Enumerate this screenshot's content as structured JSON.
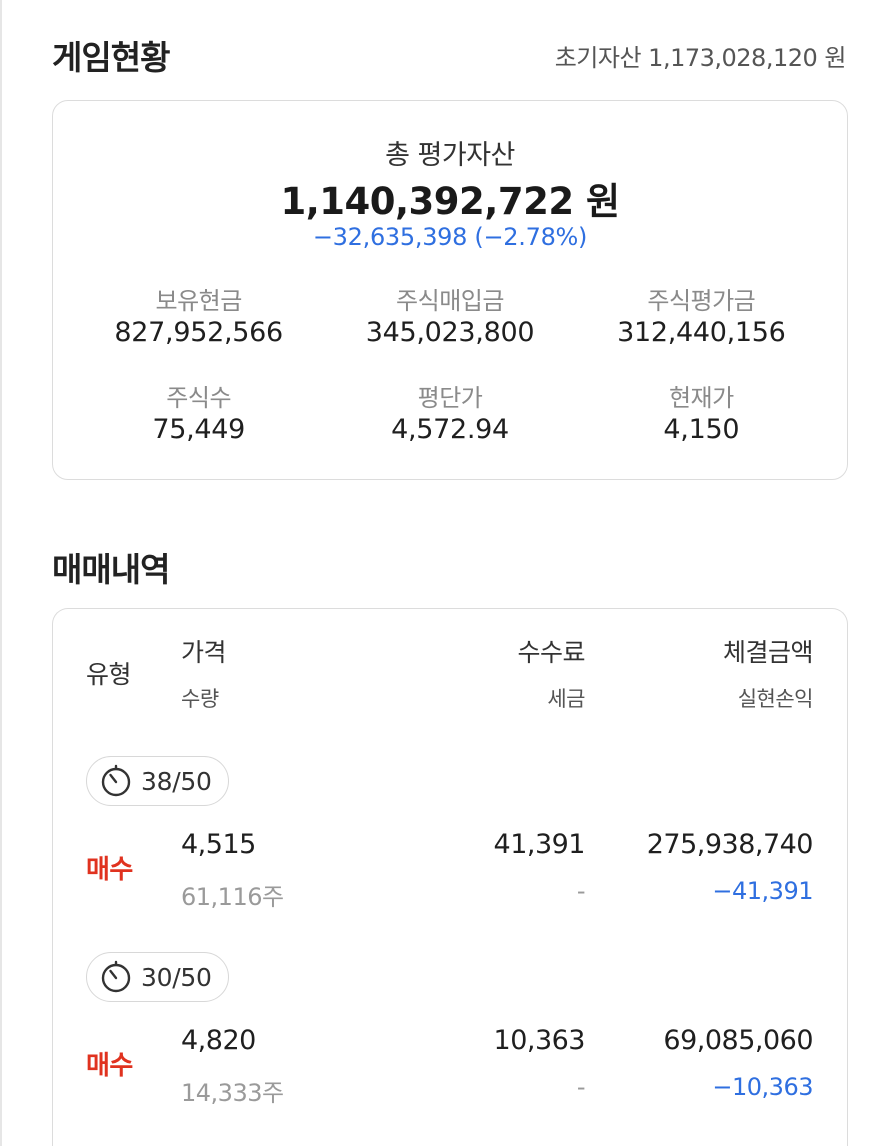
{
  "game_status": {
    "title": "게임현황",
    "initial_assets_label": "초기자산",
    "initial_assets_value": "1,173,028,120",
    "currency": "원"
  },
  "summary": {
    "total_label": "총 평가자산",
    "total_value": "1,140,392,722 원",
    "total_change": "−32,635,398 (−2.78%)",
    "stats": [
      {
        "label": "보유현금",
        "value": "827,952,566"
      },
      {
        "label": "주식매입금",
        "value": "345,023,800"
      },
      {
        "label": "주식평가금",
        "value": "312,440,156"
      },
      {
        "label": "주식수",
        "value": "75,449"
      },
      {
        "label": "평단가",
        "value": "4,572.94"
      },
      {
        "label": "현재가",
        "value": "4,150"
      }
    ]
  },
  "trades": {
    "title": "매매내역",
    "headers": {
      "type": "유형",
      "price": "가격",
      "quantity": "수량",
      "fee": "수수료",
      "tax": "세금",
      "amount": "체결금액",
      "realized": "실현손익"
    },
    "rows": [
      {
        "round": "38/50",
        "type": "매수",
        "price": "4,515",
        "quantity": "61,116주",
        "fee": "41,391",
        "tax": "-",
        "amount": "275,938,740",
        "realized": "−41,391"
      },
      {
        "round": "30/50",
        "type": "매수",
        "price": "4,820",
        "quantity": "14,333주",
        "fee": "10,363",
        "tax": "-",
        "amount": "69,085,060",
        "realized": "−10,363"
      }
    ]
  },
  "colors": {
    "buy_red": "#e0321f",
    "change_blue": "#2f6fe0",
    "muted_gray": "#8a8a8a"
  }
}
